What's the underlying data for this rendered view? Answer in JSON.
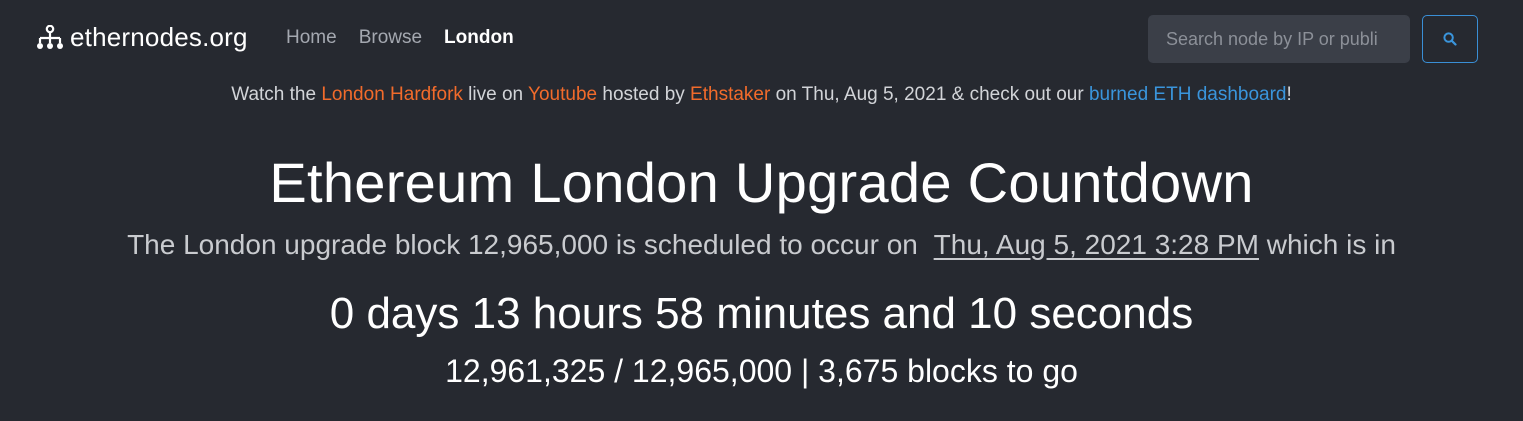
{
  "navbar": {
    "brand": "ethernodes.org",
    "brand_icon": "network-nodes-icon",
    "links": [
      {
        "label": "Home",
        "active": false
      },
      {
        "label": "Browse",
        "active": false
      },
      {
        "label": "London",
        "active": true
      }
    ],
    "search": {
      "placeholder": "Search node by IP or publi",
      "button_icon": "search-icon"
    }
  },
  "announcement": {
    "t1": "Watch the ",
    "link1": "London Hardfork",
    "t2": " live on ",
    "link2": "Youtube",
    "t3": " hosted by ",
    "link3": "Ethstaker",
    "t4": " on Thu, Aug 5, 2021 & check out our ",
    "link4": "burned ETH dashboard",
    "t5": "!"
  },
  "main": {
    "title": "Ethereum London Upgrade Countdown",
    "subtitle_prefix": "The London upgrade block 12,965,000 is scheduled to occur on ",
    "subtitle_date": "Thu, Aug 5, 2021 3:28 PM",
    "subtitle_suffix": " which is in",
    "countdown": "0 days 13 hours 58 minutes and 10 seconds",
    "blocks": "12,961,325 / 12,965,000 | 3,675 blocks to go"
  },
  "colors": {
    "background": "#262930",
    "accent_orange": "#f26b2b",
    "accent_blue": "#3a95dc"
  }
}
